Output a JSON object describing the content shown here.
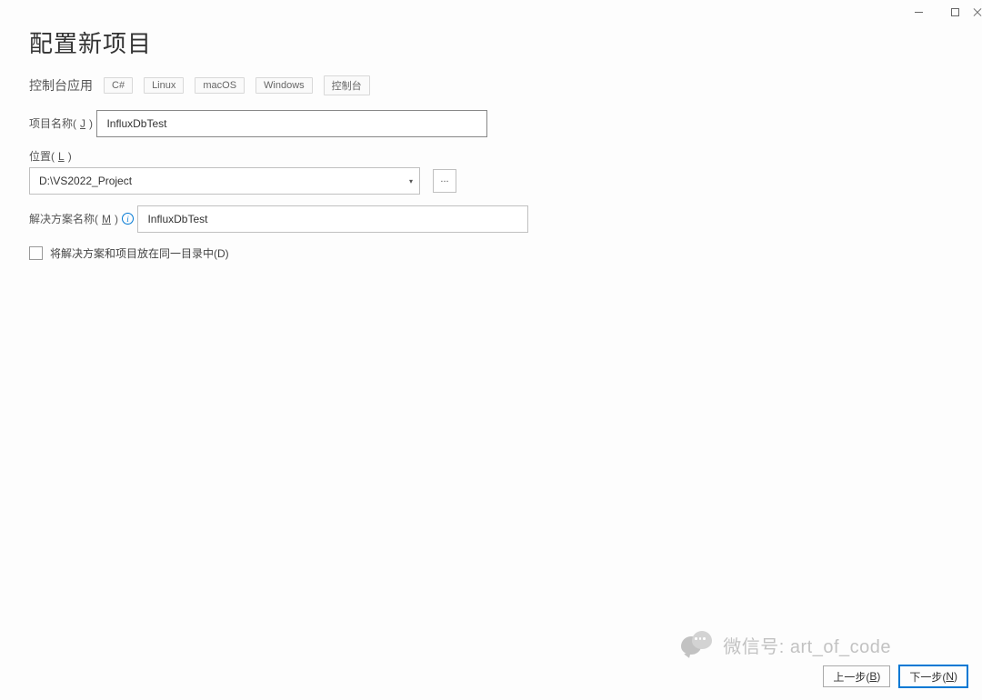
{
  "window": {
    "minimize": "minimize",
    "maximize": "maximize",
    "close": "close"
  },
  "page": {
    "title": "配置新项目",
    "subtitle": "控制台应用",
    "tags": [
      "C#",
      "Linux",
      "macOS",
      "Windows",
      "控制台"
    ]
  },
  "fields": {
    "project_name": {
      "label_text": "项目名称(",
      "hotkey": "J",
      "label_suffix": ")",
      "value": "InfluxDbTest"
    },
    "location": {
      "label_text": "位置(",
      "hotkey": "L",
      "label_suffix": ")",
      "value": "D:\\VS2022_Project",
      "browse": "..."
    },
    "solution_name": {
      "label_text": "解决方案名称(",
      "hotkey": "M",
      "label_suffix": ")",
      "value": "InfluxDbTest"
    },
    "same_dir": {
      "label_text": "将解决方案和项目放在同一目录中(",
      "hotkey": "D",
      "label_suffix": ")",
      "checked": false
    }
  },
  "footer": {
    "back_text": "上一步(",
    "back_hotkey": "B",
    "back_suffix": ")",
    "next_text": "下一步(",
    "next_hotkey": "N",
    "next_suffix": ")"
  },
  "watermark": {
    "text": "微信号: art_of_code"
  }
}
